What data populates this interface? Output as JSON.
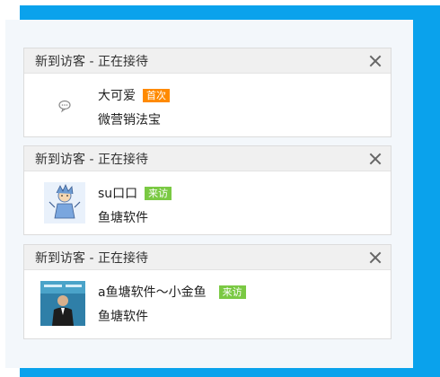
{
  "cards": [
    {
      "title": "新到访客 - 正在接待",
      "name": "大可爱",
      "badge": "首次",
      "badge_color": "#ff8a00",
      "sub": "微营销法宝",
      "avatar_icon": "chat-bubble-icon"
    },
    {
      "title": "新到访客 - 正在接待",
      "name": "su口口",
      "badge": "来访",
      "badge_color": "#7ac943",
      "sub": "鱼塘软件",
      "avatar_icon": "cartoon-avatar"
    },
    {
      "title": "新到访客 - 正在接待",
      "name": "a鱼塘软件～小金鱼",
      "badge": "来访",
      "badge_color": "#7ac943",
      "sub": "鱼塘软件",
      "avatar_icon": "photo-avatar"
    }
  ],
  "colors": {
    "frame": "#0aa2ec",
    "panel": "#f3f7fb",
    "header": "#f0f0f0"
  }
}
